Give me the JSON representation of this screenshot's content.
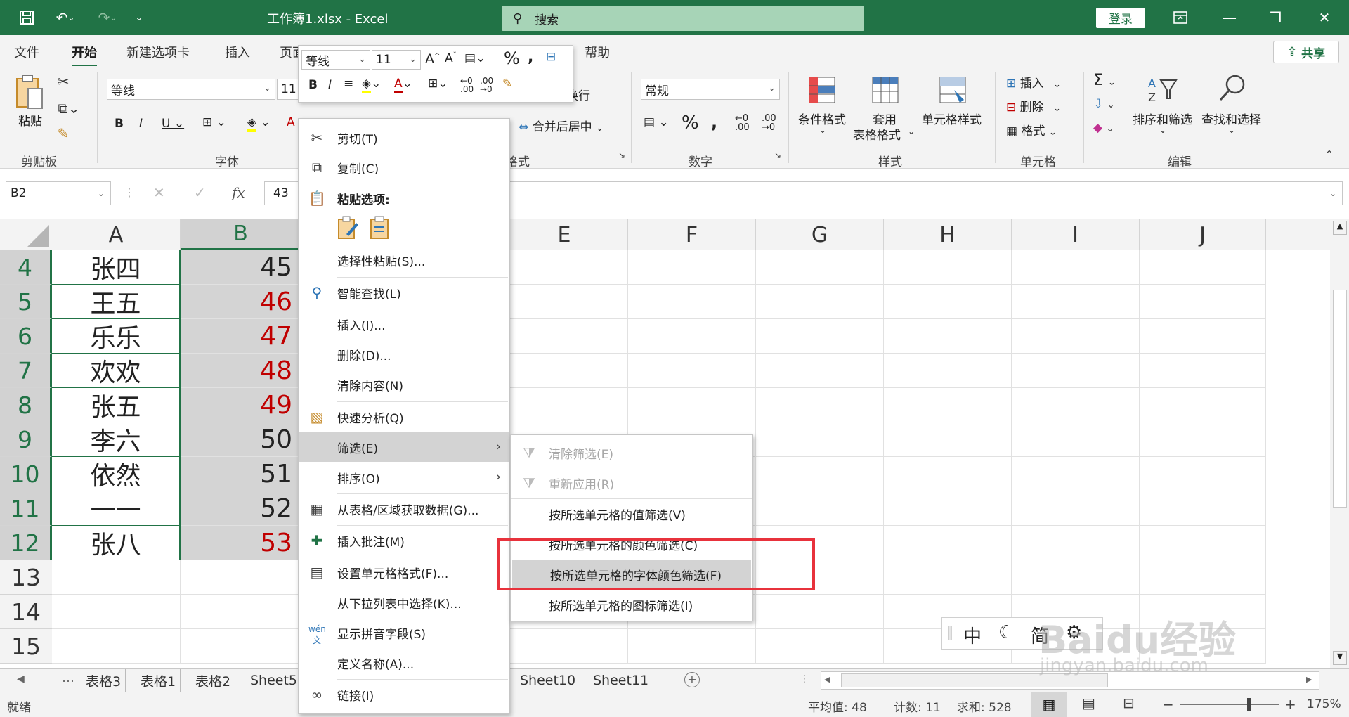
{
  "title_bar": {
    "file_title": "工作簿1.xlsx - Excel",
    "search_placeholder": "搜索",
    "login_label": "登录"
  },
  "ribbon_tabs": [
    "文件",
    "开始",
    "新建选项卡",
    "插入",
    "页面",
    "帮助"
  ],
  "share_label": "共享",
  "ribbon": {
    "clipboard": {
      "paste_label": "粘贴",
      "group_label": "剪贴板"
    },
    "font": {
      "font_name": "等线",
      "font_size": "11",
      "group_label": "字体"
    },
    "alignment": {
      "merge_center_label": "合并后居中",
      "wrap_label": "换行",
      "group_label": "格式"
    },
    "number": {
      "format": "常规",
      "group_label": "数字"
    },
    "styles": {
      "conditional_label": "条件格式",
      "table_label_1": "套用",
      "table_label_2": "表格格式",
      "cell_styles_label": "单元格样式",
      "group_label": "样式"
    },
    "cells": {
      "insert_label": "插入",
      "delete_label": "删除",
      "format_label": "格式",
      "group_label": "单元格"
    },
    "editing": {
      "sort_filter_label": "排序和筛选",
      "find_select_label": "查找和选择",
      "group_label": "编辑"
    }
  },
  "mini_toolbar": {
    "font_name": "等线",
    "font_size": "11"
  },
  "formula_bar": {
    "name_box": "B2",
    "value": "43"
  },
  "columns": [
    "A",
    "B",
    "E",
    "F",
    "G",
    "H",
    "I",
    "J"
  ],
  "rows": [
    {
      "num": "4",
      "a": "张四",
      "b": "45",
      "b_color": "#222222"
    },
    {
      "num": "5",
      "a": "王五",
      "b": "46",
      "b_color": "#c00000"
    },
    {
      "num": "6",
      "a": "乐乐",
      "b": "47",
      "b_color": "#c00000"
    },
    {
      "num": "7",
      "a": "欢欢",
      "b": "48",
      "b_color": "#c00000"
    },
    {
      "num": "8",
      "a": "张五",
      "b": "49",
      "b_color": "#c00000"
    },
    {
      "num": "9",
      "a": "李六",
      "b": "50",
      "b_color": "#222222"
    },
    {
      "num": "10",
      "a": "依然",
      "b": "51",
      "b_color": "#222222"
    },
    {
      "num": "11",
      "a": "一一",
      "b": "52",
      "b_color": "#222222"
    },
    {
      "num": "12",
      "a": "张八",
      "b": "53",
      "b_color": "#c00000"
    },
    {
      "num": "13",
      "a": "",
      "b": "",
      "b_color": "#222222"
    },
    {
      "num": "14",
      "a": "",
      "b": "",
      "b_color": "#222222"
    },
    {
      "num": "15",
      "a": "",
      "b": "",
      "b_color": "#222222"
    }
  ],
  "context_menu": {
    "cut": "剪切(T)",
    "copy": "复制(C)",
    "paste_options": "粘贴选项:",
    "paste_special": "选择性粘贴(S)...",
    "smart_lookup": "智能查找(L)",
    "insert": "插入(I)...",
    "delete": "删除(D)...",
    "clear": "清除内容(N)",
    "quick_analysis": "快速分析(Q)",
    "filter": "筛选(E)",
    "sort": "排序(O)",
    "get_data": "从表格/区域获取数据(G)...",
    "insert_comment": "插入批注(M)",
    "format_cells": "设置单元格格式(F)...",
    "pick_list": "从下拉列表中选择(K)...",
    "phonetic": "显示拼音字段(S)",
    "define_name": "定义名称(A)...",
    "link": "链接(I)"
  },
  "filter_submenu": {
    "clear_filter": "清除筛选(E)",
    "reapply": "重新应用(R)",
    "by_value": "按所选单元格的值筛选(V)",
    "by_color": "按所选单元格的颜色筛选(C)",
    "by_font_color": "按所选单元格的字体颜色筛选(F)",
    "by_icon": "按所选单元格的图标筛选(I)"
  },
  "sheet_tabs": [
    "表格3",
    "表格1",
    "表格2",
    "Sheet5",
    "Sheet10",
    "Sheet11"
  ],
  "status_bar": {
    "mode": "就绪",
    "average": "平均值: 48",
    "count": "计数: 11",
    "sum": "求和: 528",
    "zoom": "175%"
  },
  "ime_bar": {
    "lang": "中",
    "mode": "简"
  },
  "watermark": {
    "brand": "Baidu经验",
    "url": "jingyan.baidu.com"
  }
}
